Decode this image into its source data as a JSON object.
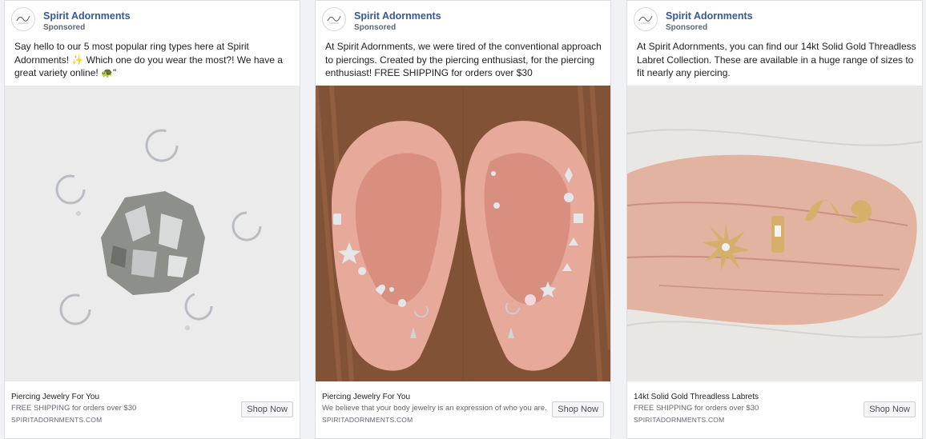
{
  "ads": [
    {
      "page_name": "Spirit Adornments",
      "sponsored_label": "Sponsored",
      "body_text": "Say hello to our 5 most popular ring types here at Spirit Adornments! ✨ Which one do you wear the most?! We have a great variety online! 🐢\"",
      "footer": {
        "title": "Piercing Jewelry For You",
        "description": "FREE SHIPPING for orders over $30",
        "url": "SPIRITADORNMENTS.COM",
        "cta_label": "Shop Now"
      }
    },
    {
      "page_name": "Spirit Adornments",
      "sponsored_label": "Sponsored",
      "body_text": "At Spirit Adornments, we were tired of the conventional approach to piercings. Created by the piercing enthusiast, for the piercing enthusiast! FREE SHIPPING for orders over $30",
      "footer": {
        "title": "Piercing Jewelry For You",
        "description": "We believe that your body jewelry is an expression of who you are.",
        "url": "SPIRITADORNMENTS.COM",
        "cta_label": "Shop Now"
      }
    },
    {
      "page_name": "Spirit Adornments",
      "sponsored_label": "Sponsored",
      "body_text": "At Spirit Adornments, you can find our 14kt Solid Gold Threadless Labret Collection. These are available in a huge range of sizes to fit nearly any piercing.",
      "footer": {
        "title": "14kt Solid Gold Threadless Labrets",
        "description": "FREE SHIPPING for orders over $30",
        "url": "SPIRITADORNMENTS.COM",
        "cta_label": "Shop Now"
      }
    }
  ],
  "colors": {
    "page_name": "#365899",
    "card_border": "#dddfe2",
    "background": "#f0f2f5",
    "gold": "#d4b06a",
    "silver": "#b8bcc2"
  }
}
